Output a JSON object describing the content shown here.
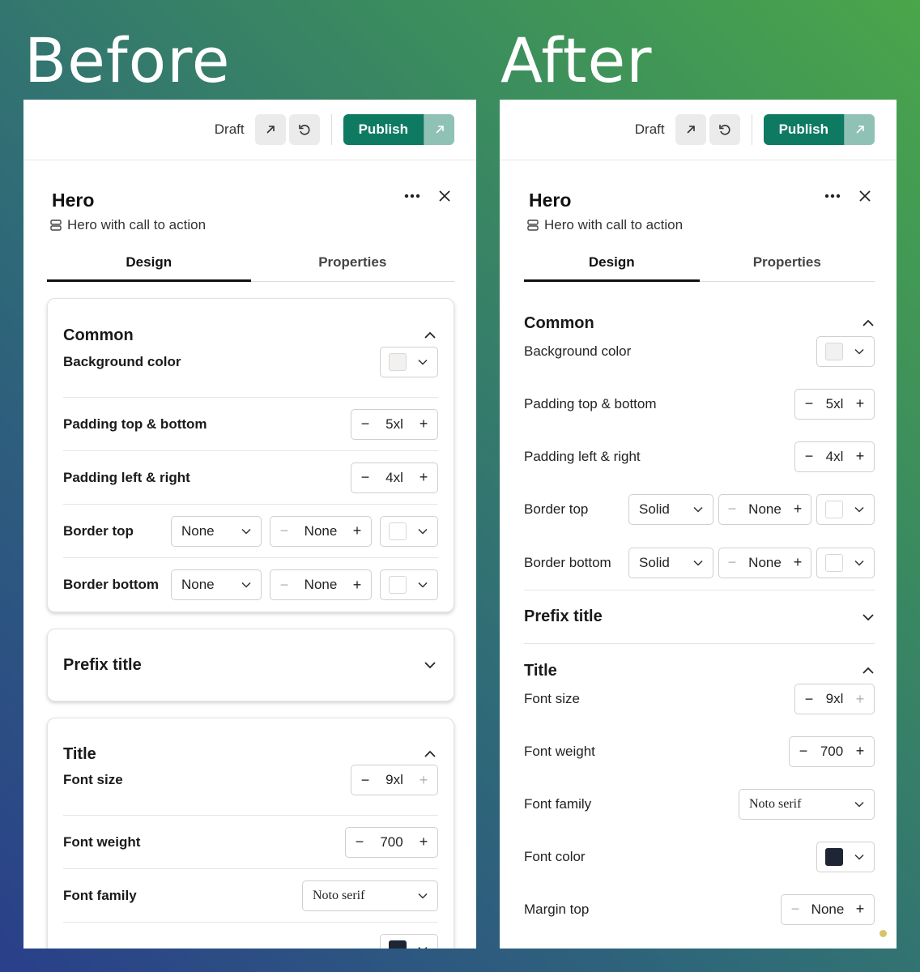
{
  "labels": {
    "before": "Before",
    "after": "After"
  },
  "topbar": {
    "draft": "Draft",
    "publish": "Publish"
  },
  "hero": {
    "title": "Hero",
    "subtitle": "Hero with call to action"
  },
  "tabs": {
    "design": "Design",
    "properties": "Properties"
  },
  "common": {
    "title": "Common",
    "background_color": "Background color",
    "padding_tb": "Padding top & bottom",
    "padding_tb_value": "5xl",
    "padding_lr": "Padding left & right",
    "padding_lr_value": "4xl",
    "border_top": "Border top",
    "border_bottom": "Border bottom",
    "before_style": "None",
    "after_style": "Solid",
    "width_value": "None"
  },
  "prefix": {
    "title": "Prefix title"
  },
  "title_section": {
    "title": "Title",
    "font_size": "Font size",
    "font_size_value": "9xl",
    "font_weight": "Font weight",
    "font_weight_value": "700",
    "font_family": "Font family",
    "font_family_value": "Noto serif",
    "font_color": "Font color",
    "margin_top": "Margin top",
    "margin_top_value": "None"
  },
  "colors": {
    "publish": "#0e7a62",
    "font_color_swatch": "#1e2535"
  }
}
